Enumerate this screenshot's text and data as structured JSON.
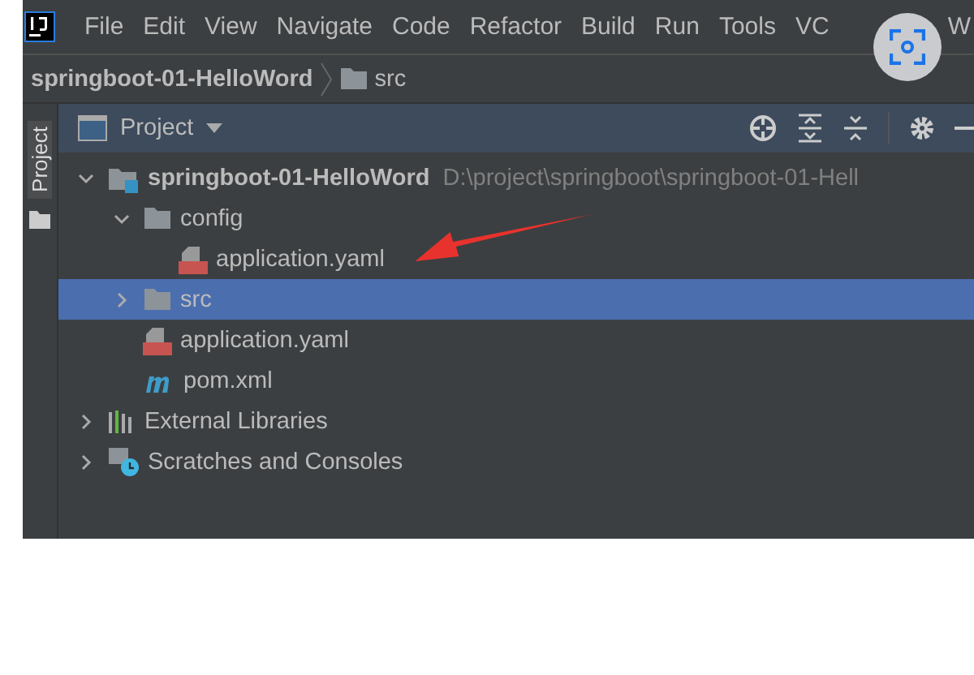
{
  "menu_bar": {
    "items": [
      "File",
      "Edit",
      "View",
      "Navigate",
      "Code",
      "Refactor",
      "Build",
      "Run",
      "Tools",
      "VC",
      "W"
    ]
  },
  "breadcrumb": {
    "items": [
      {
        "label": "springboot-01-HelloWord",
        "kind": "project"
      },
      {
        "label": "src",
        "kind": "folder"
      }
    ]
  },
  "tool_strip": {
    "label": "Project",
    "selected": true
  },
  "project_panel": {
    "title": "Project",
    "tree": [
      {
        "label": "springboot-01-HelloWord",
        "kind": "module",
        "path": "D:\\project\\springboot\\springboot-01-Hell",
        "expanded": true,
        "selected": false,
        "children": [
          {
            "label": "config",
            "kind": "folder",
            "expanded": true,
            "selected": false,
            "children": [
              {
                "label": "application.yaml",
                "kind": "yaml",
                "selected": false
              }
            ]
          },
          {
            "label": "src",
            "kind": "folder",
            "expanded": false,
            "selected": true
          },
          {
            "label": "application.yaml",
            "kind": "yaml",
            "selected": false
          },
          {
            "label": "pom.xml",
            "kind": "maven",
            "selected": false
          }
        ]
      },
      {
        "label": "External Libraries",
        "kind": "library",
        "expanded": false,
        "selected": false
      },
      {
        "label": "Scratches and Consoles",
        "kind": "scratch",
        "expanded": false,
        "selected": false
      }
    ]
  }
}
